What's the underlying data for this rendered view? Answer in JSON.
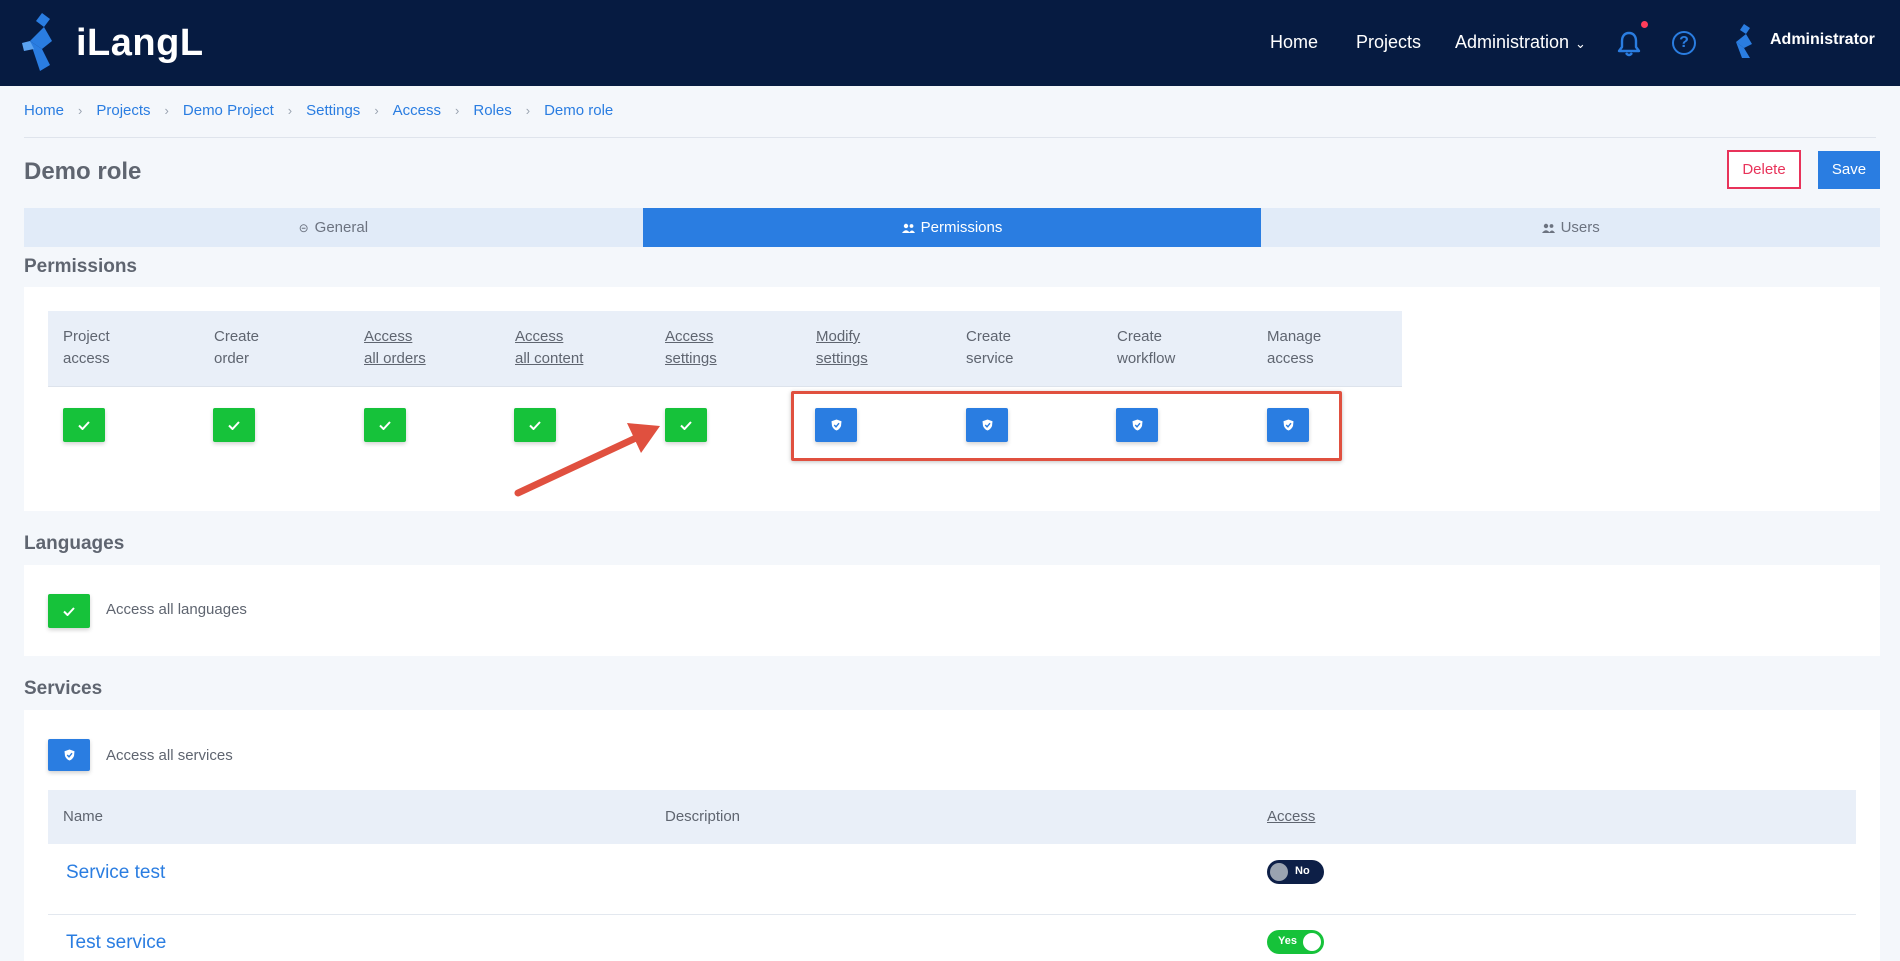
{
  "app": {
    "logo_text": "iLangL"
  },
  "nav": {
    "home": "Home",
    "projects": "Projects",
    "administration": "Administration",
    "help_glyph": "?",
    "user": "Administrator"
  },
  "breadcrumb": [
    "Home",
    "Projects",
    "Demo Project",
    "Settings",
    "Access",
    "Roles",
    "Demo role"
  ],
  "page": {
    "title": "Demo role",
    "delete_label": "Delete",
    "save_label": "Save"
  },
  "tabs": [
    {
      "label": "General",
      "icon": "minus-circle-icon",
      "active": false
    },
    {
      "label": "Permissions",
      "icon": "users-icon",
      "active": true
    },
    {
      "label": "Users",
      "icon": "users-icon",
      "active": false
    }
  ],
  "permissions": {
    "title": "Permissions",
    "columns": [
      {
        "line1": "Project",
        "line2": "access",
        "underlined": false,
        "state": "checked"
      },
      {
        "line1": "Create",
        "line2": "order",
        "underlined": false,
        "state": "checked"
      },
      {
        "line1": "Access",
        "line2": "all orders",
        "underlined": true,
        "state": "checked"
      },
      {
        "line1": "Access",
        "line2": "all content",
        "underlined": true,
        "state": "checked"
      },
      {
        "line1": "Access",
        "line2": "settings",
        "underlined": true,
        "state": "checked"
      },
      {
        "line1": "Modify",
        "line2": "settings",
        "underlined": true,
        "state": "inherited"
      },
      {
        "line1": "Create",
        "line2": "service",
        "underlined": false,
        "state": "inherited"
      },
      {
        "line1": "Create",
        "line2": "workflow",
        "underlined": false,
        "state": "inherited"
      },
      {
        "line1": "Manage",
        "line2": "access",
        "underlined": false,
        "state": "inherited"
      }
    ]
  },
  "languages": {
    "title": "Languages",
    "access_all_label": "Access all languages",
    "state": "checked"
  },
  "services": {
    "title": "Services",
    "access_all_label": "Access all services",
    "state": "inherited",
    "headers": {
      "name": "Name",
      "description": "Description",
      "access": "Access"
    },
    "rows": [
      {
        "name": "Service test",
        "description": "",
        "access": "No"
      },
      {
        "name": "Test service",
        "description": "",
        "access": "Yes"
      }
    ]
  },
  "colors": {
    "navbar": "#061b41",
    "accent": "#2a7de1",
    "checked": "#16c23a",
    "danger": "#e8335a",
    "annotation": "#e0503f"
  }
}
